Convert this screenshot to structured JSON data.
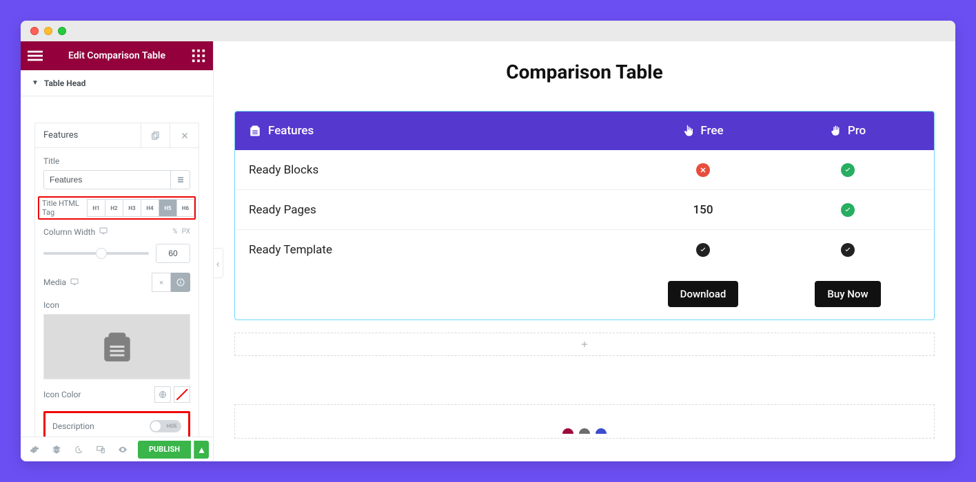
{
  "sidebar": {
    "header_title": "Edit Comparison Table",
    "section_label": "Table Head",
    "features_card_title": "Features",
    "title_label": "Title",
    "title_value": "Features",
    "title_tag_label": "Title HTML Tag",
    "tags": [
      "H1",
      "H2",
      "H3",
      "H4",
      "H5",
      "H6"
    ],
    "tag_active": "H5",
    "column_width_label": "Column Width",
    "column_width_value": "60",
    "units": {
      "a": "%",
      "b": "PX"
    },
    "media_label": "Media",
    "icon_label": "Icon",
    "icon_color_label": "Icon Color",
    "description_label": "Description",
    "description_toggle_text": "HIDE",
    "publish_label": "PUBLISH"
  },
  "canvas": {
    "title": "Comparison Table",
    "head": {
      "features": "Features",
      "plans": [
        "Free",
        "Pro"
      ]
    },
    "rows": [
      {
        "label": "Ready Blocks",
        "free": {
          "type": "badge",
          "variant": "red"
        },
        "pro": {
          "type": "badge",
          "variant": "green"
        }
      },
      {
        "label": "Ready Pages",
        "free": {
          "type": "text",
          "value": "150"
        },
        "pro": {
          "type": "badge",
          "variant": "green"
        }
      },
      {
        "label": "Ready Template",
        "free": {
          "type": "badge",
          "variant": "dark"
        },
        "pro": {
          "type": "badge",
          "variant": "dark"
        }
      }
    ],
    "actions": {
      "free": "Download",
      "pro": "Buy Now"
    }
  }
}
